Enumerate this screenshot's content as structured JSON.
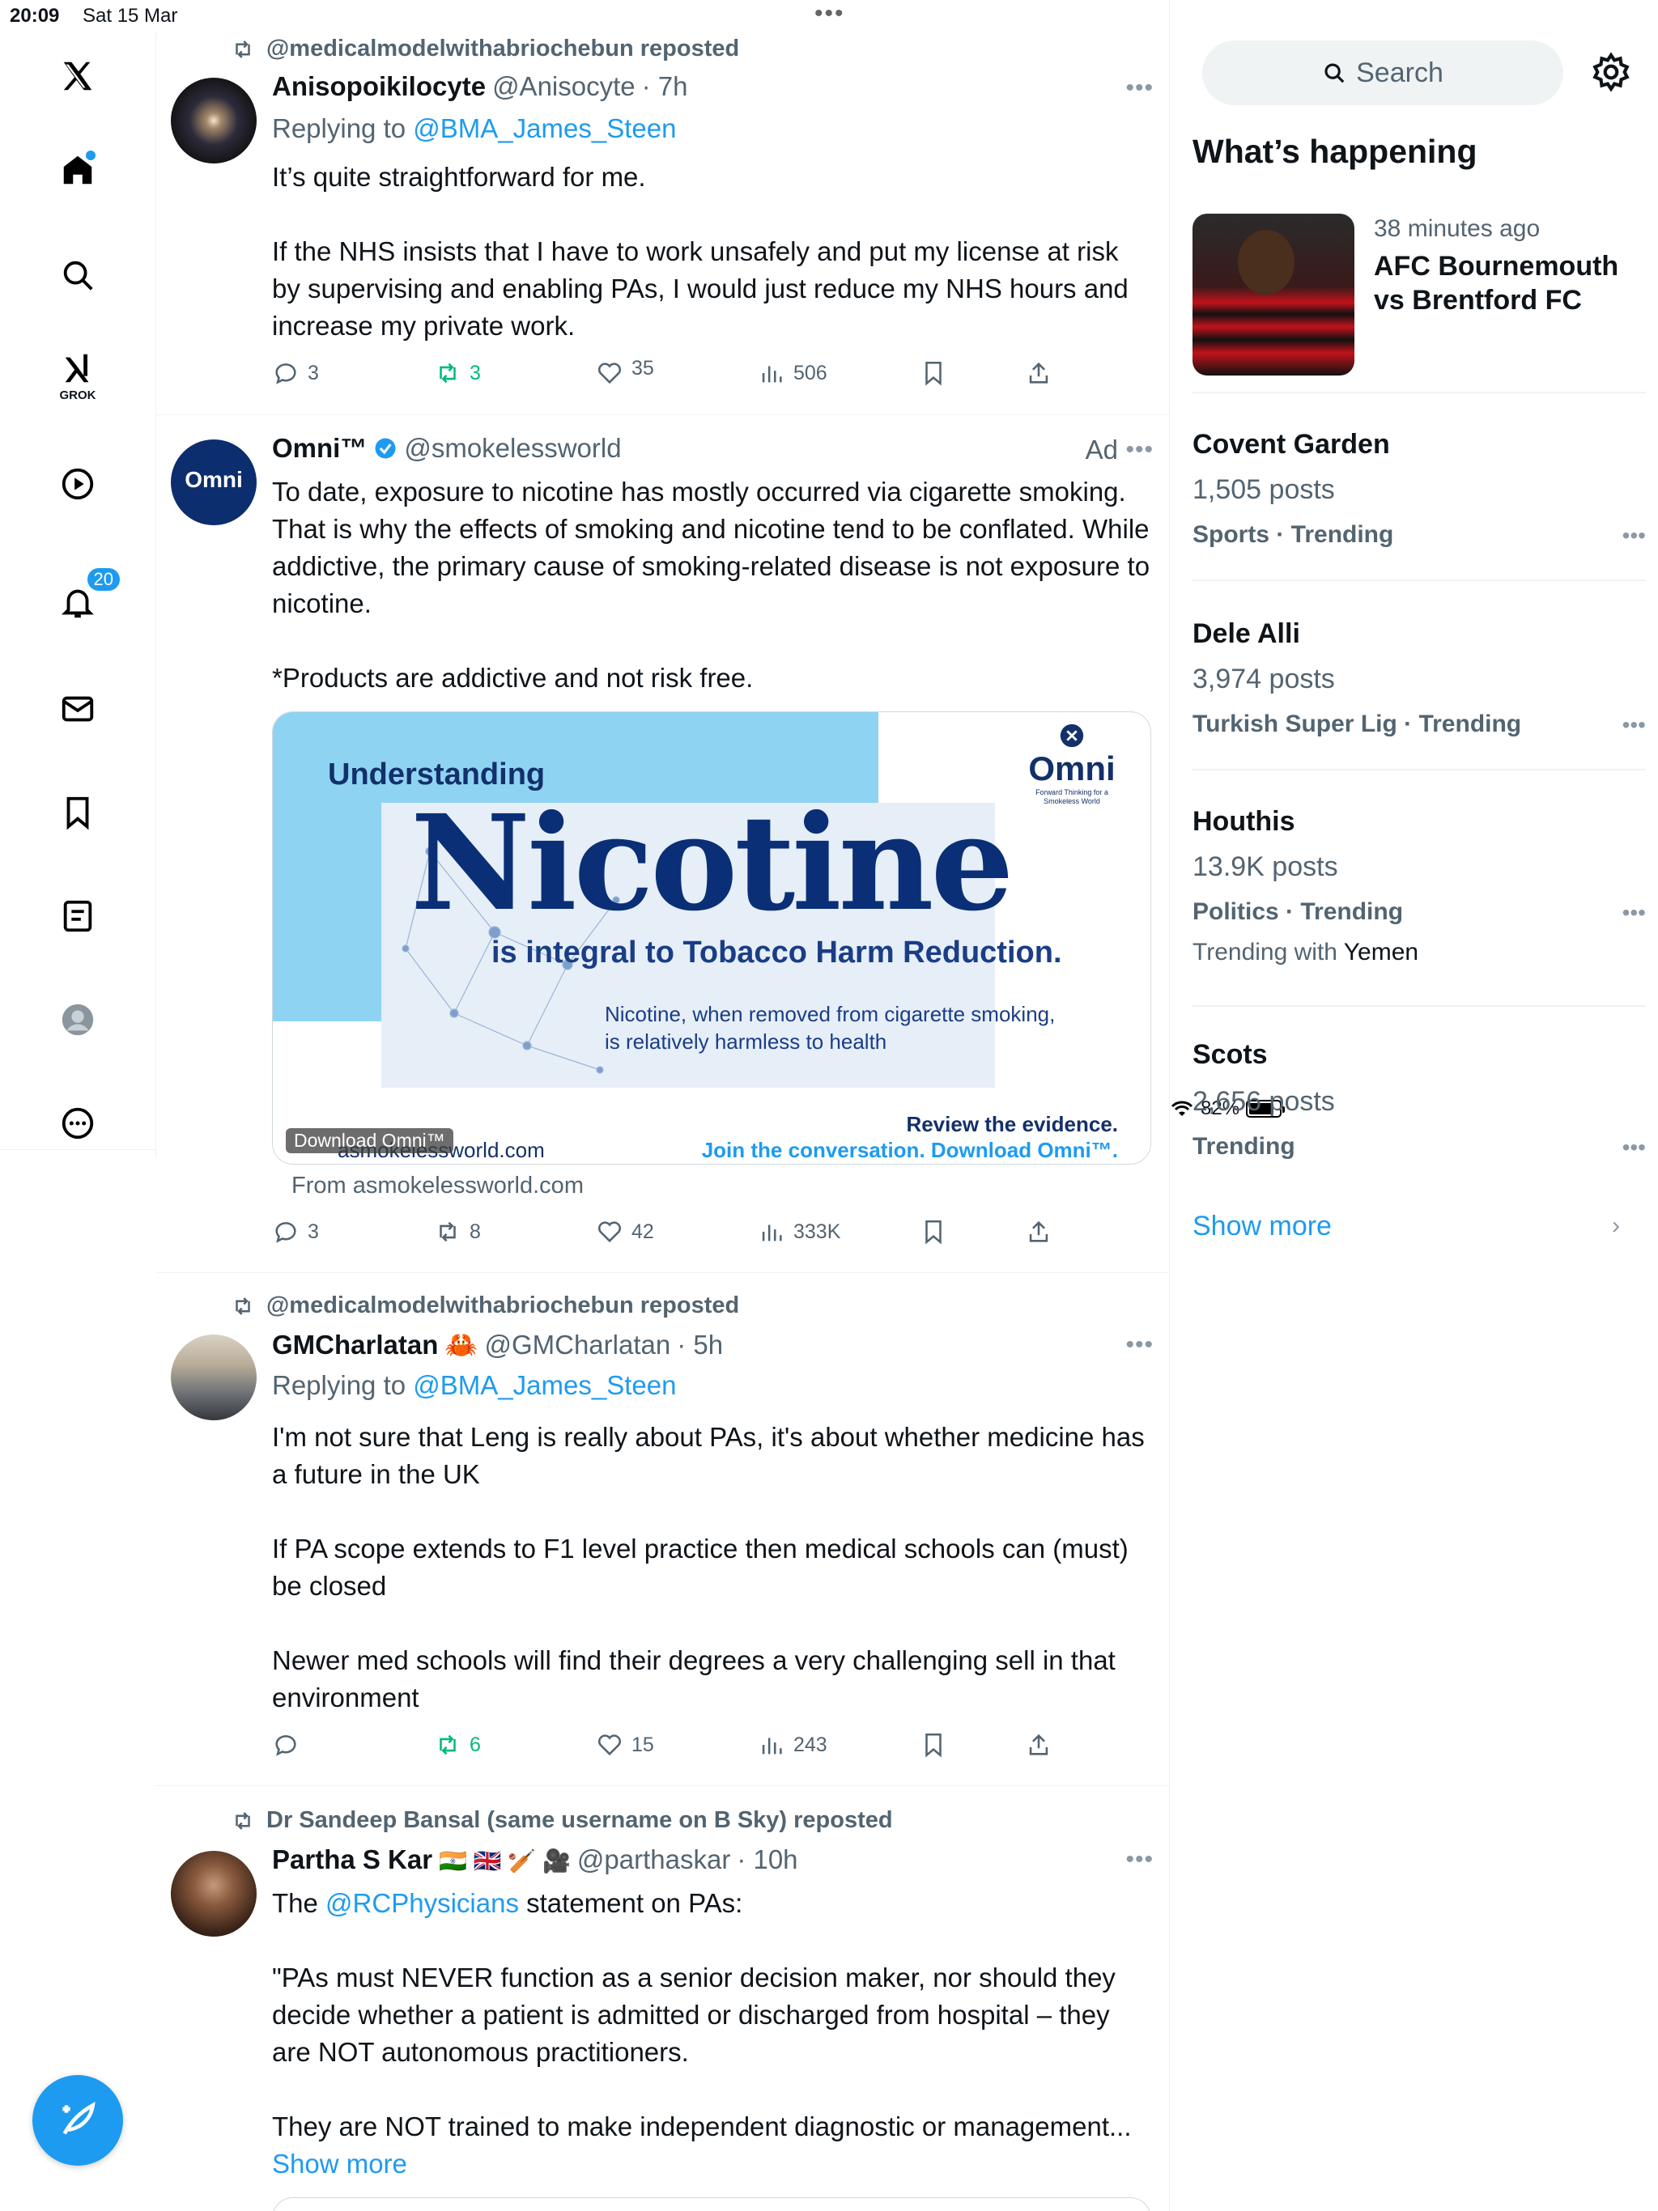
{
  "status": {
    "time": "20:09",
    "date": "Sat 15 Mar",
    "battery": "82%",
    "battery_level": 0.82
  },
  "nav": {
    "notifications_badge": "20",
    "grok_label": "GROK"
  },
  "tweets": [
    {
      "reposted_by": "@medicalmodelwithabriochebun reposted",
      "name": "Anisopoikilocyte",
      "handle": "@Anisocyte",
      "time": "· 7h",
      "replying_prefix": "Replying to",
      "replying_to": "@BMA_James_Steen",
      "paragraphs": [
        "It’s quite straightforward for me.",
        "If the NHS insists that I have to work unsafely and put my license at risk by supervising and enabling PAs, I would just reduce my NHS hours and increase my private work."
      ],
      "replies": "3",
      "reposts": "3",
      "likes": "35",
      "views": "506"
    },
    {
      "name": "Omni™",
      "handle": "@smokelessworld",
      "ad_label": "Ad",
      "paragraphs": [
        "To date, exposure to nicotine has mostly occurred via cigarette smoking. That is why the effects of smoking and nicotine tend to be conflated. While addictive, the primary cause of smoking-related disease is not exposure to nicotine.",
        "*Products are addictive and not risk free."
      ],
      "card": {
        "understanding": "Understanding",
        "headline": "Nicotine",
        "subhead": "is integral to Tobacco Harm Reduction.",
        "small_text": "Nicotine, when removed from cigarette smoking, is relatively harmless to health",
        "logo_word": "Omni",
        "logo_tag": "Forward Thinking for a Smokeless World",
        "review": "Review the evidence.",
        "join": "Join the conversation. Download Omni™.",
        "download_badge": "Download Omni™",
        "domain": "asmokelessworld.com"
      },
      "from": "From asmokelessworld.com",
      "replies": "3",
      "reposts": "8",
      "likes": "42",
      "views": "333K"
    },
    {
      "reposted_by": "@medicalmodelwithabriochebun reposted",
      "name": "GMCharlatan",
      "name_emoji": "🦀",
      "handle": "@GMCharlatan",
      "time": "· 5h",
      "replying_prefix": "Replying to",
      "replying_to": "@BMA_James_Steen",
      "paragraphs": [
        "I'm not sure that Leng is really about PAs, it's about whether medicine has a future in the UK",
        "If PA scope extends to F1 level practice then medical schools can (must) be closed",
        "Newer med schools will find their degrees a very challenging sell in that environment"
      ],
      "replies": "",
      "reposts": "6",
      "likes": "15",
      "views": "243"
    },
    {
      "reposted_by": "Dr Sandeep Bansal (same username on B Sky) reposted",
      "name": "Partha S Kar",
      "name_emoji": "🇮🇳 🇬🇧 🏏 🎥",
      "handle": "@parthaskar",
      "time": "· 10h",
      "intro_prefix": "The",
      "intro_mention": "@RCPhysicians",
      "intro_suffix": "statement on PAs:",
      "paragraphs": [
        "\"PAs must NEVER function as a senior decision maker, nor should they decide whether a patient is admitted or discharged from hospital – they are NOT autonomous practitioners.",
        "They are NOT trained to make independent diagnostic or management..."
      ],
      "show_more": "Show more"
    }
  ],
  "sidebar": {
    "search_placeholder": "Search",
    "whats_happening": "What’s happening",
    "news": {
      "time": "38 minutes ago",
      "title": "AFC Bournemouth vs Brentford FC"
    },
    "trends": [
      {
        "name": "Covent Garden",
        "posts": "1,505 posts",
        "meta": "Sports · Trending",
        "with_prefix": "",
        "with": ""
      },
      {
        "name": "Dele Alli",
        "posts": "3,974 posts",
        "meta": "Turkish Super Lig · Trending",
        "with_prefix": "",
        "with": ""
      },
      {
        "name": "Houthis",
        "posts": "13.9K posts",
        "meta": "Politics · Trending",
        "with_prefix": "Trending with",
        "with": "Yemen"
      },
      {
        "name": "Scots",
        "posts": "2,656 posts",
        "meta": "Trending",
        "with_prefix": "",
        "with": ""
      }
    ],
    "show_more": "Show more"
  },
  "colors": {
    "accent": "#1d9bf0",
    "repost_green": "#00ba7c",
    "muted": "#536471"
  }
}
